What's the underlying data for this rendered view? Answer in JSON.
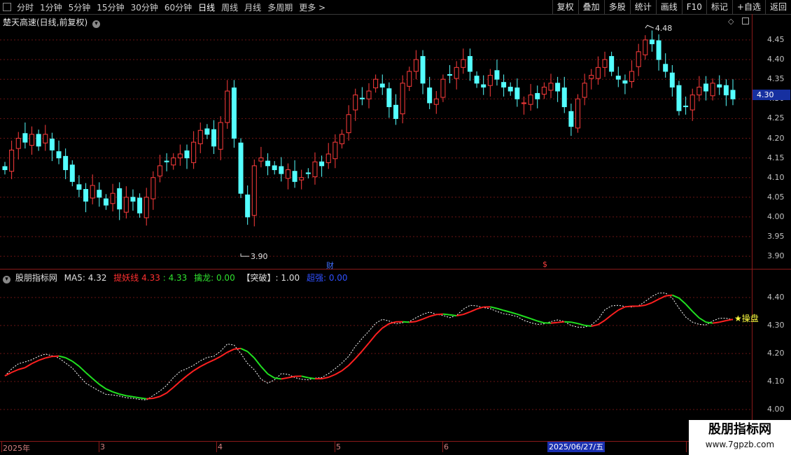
{
  "toolbar": {
    "periods": [
      "分时",
      "1分钟",
      "5分钟",
      "15分钟",
      "30分钟",
      "60分钟",
      "日线",
      "周线",
      "月线",
      "多周期",
      "更多 >"
    ],
    "active_period": "日线",
    "tools": [
      "复权",
      "叠加",
      "多股",
      "统计",
      "画线",
      "F10",
      "标记",
      "+自选",
      "返回"
    ]
  },
  "main": {
    "title": "楚天高速(日线,前复权)",
    "y_ticks": [
      "4.45",
      "4.40",
      "4.35",
      "4.30",
      "4.25",
      "4.20",
      "4.15",
      "4.10",
      "4.05",
      "4.00",
      "3.95",
      "3.90"
    ],
    "current_price": "4.30",
    "high_label": "4.48",
    "low_label": "3.90",
    "markers": {
      "cai": "财",
      "dollar": "$"
    }
  },
  "indicator": {
    "site": "股朋指标网",
    "ma5_label": "MA5:",
    "ma5_value": "4.32",
    "tyx_label": "提妖线",
    "tyx_value1": "4.33",
    "tyx_sep": ":",
    "tyx_value2": "4.33",
    "qinlong_label": "擒龙:",
    "qinlong_value": "0.00",
    "tupo_label": "【突破】:",
    "tupo_value": "1.00",
    "chaoqiang_label": "超强:",
    "chaoqiang_value": "0.00",
    "y_ticks": [
      "4.40",
      "4.30",
      "4.20",
      "4.10",
      "4.00"
    ],
    "end_tag": "★操盘"
  },
  "dates": {
    "labels": [
      "2025年",
      "3",
      "4",
      "5",
      "6"
    ],
    "highlight": "2025/06/27/五"
  },
  "watermark": {
    "name": "股朋指标网",
    "url": "www.7gpzb.com"
  },
  "colors": {
    "up": "#ff3c3c",
    "down": "#54ffff",
    "tyx_up": "#ff2020",
    "tyx_down": "#20e020",
    "ma5": "#ffffff",
    "axis": "#8b1a1a",
    "grid": "#8b1a1a"
  }
}
